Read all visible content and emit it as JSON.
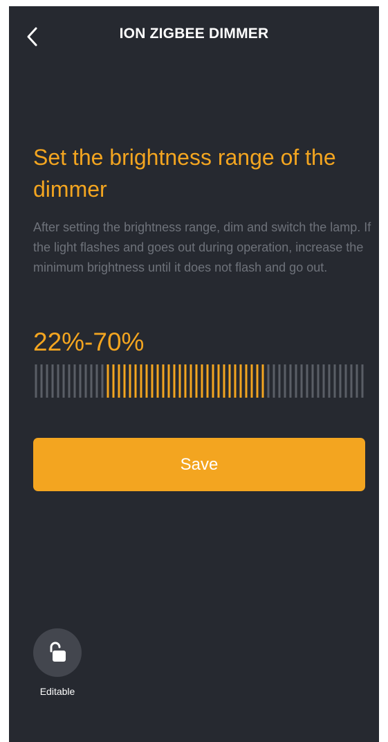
{
  "header": {
    "title": "ION ZIGBEE DIMMER",
    "back_icon": "chevron-left-icon"
  },
  "main": {
    "heading": "Set the brightness range of the dimmer",
    "description": "After setting the brightness range, dim and switch the lamp. If the light flashes and goes out during operation, increase the minimum brightness until it does not flash and go out.",
    "range_text": "22%-70%",
    "range": {
      "min_percent": 22,
      "max_percent": 70
    },
    "save_label": "Save"
  },
  "lock": {
    "icon": "unlocked-padlock-icon",
    "label": "Editable"
  },
  "colors": {
    "background": "#262930",
    "accent": "#f3a520",
    "muted_text": "#6e727a",
    "inactive_tick": "#5a5e66",
    "lock_circle": "#43464e"
  }
}
